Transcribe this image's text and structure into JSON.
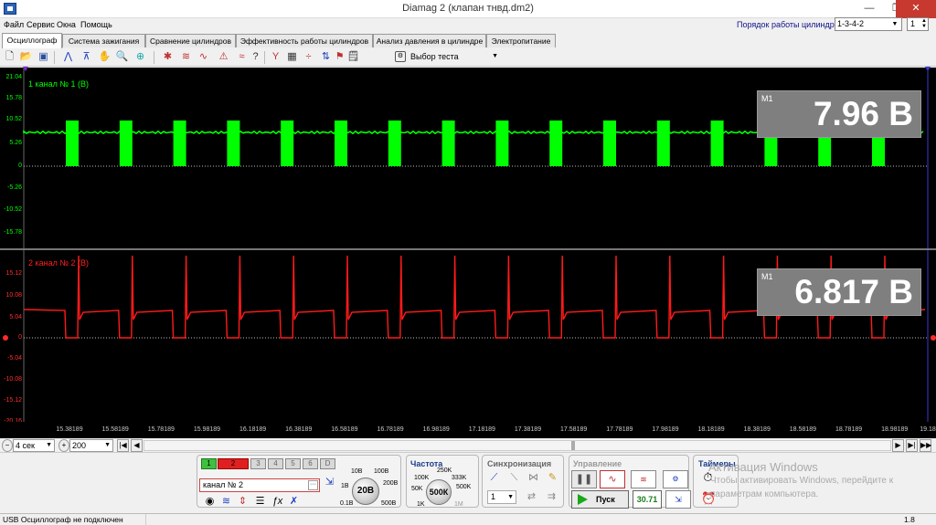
{
  "window": {
    "title": "Diamag 2 (клапан тнвд.dm2)",
    "minimize": "—",
    "maximize": "❐",
    "close": "✕"
  },
  "menu": [
    "Файл",
    "Сервис",
    "Окна",
    "Помощь"
  ],
  "cylinder_order": {
    "label": "Порядок работы цилиндров",
    "value": "1-3-4-2",
    "number": "1"
  },
  "tabs": [
    "Осциллограф",
    "Система зажигания",
    "Сравнение цилиндров",
    "Эффективность работы цилиндров",
    "Анализ давления в цилиндре",
    "Электропитание"
  ],
  "active_tab": "Осциллограф",
  "toolbar": {
    "test_select": "Выбор теста"
  },
  "channel1": {
    "label": "1  канал № 1 (В)",
    "color": "#00ff00",
    "yticks": [
      "21.04",
      "15.78",
      "10.52",
      "5.26",
      "0",
      "-5.26",
      "-10.52",
      "-15.78"
    ],
    "marker": "M1",
    "value": "7.96 В"
  },
  "channel2": {
    "label": "2  канал № 2 (В)",
    "color": "#ff1a1a",
    "yticks": [
      "15.12",
      "10.08",
      "5.04",
      "0",
      "-5.04",
      "-10.08",
      "-15.12",
      "-20.16"
    ],
    "marker": "M1",
    "value": "6.817 В"
  },
  "x_ticks": [
    "15.38189",
    "15.58189",
    "15.78189",
    "15.98189",
    "16.18189",
    "16.38189",
    "16.58189",
    "16.78189",
    "16.98189",
    "17.18189",
    "17.38189",
    "17.58189",
    "17.78189",
    "17.98189",
    "18.18189",
    "18.38189",
    "18.58189",
    "18.78189",
    "18.98189",
    "19.18189"
  ],
  "time_scale": {
    "value": "4 сек",
    "points": "200"
  },
  "controls": {
    "channel_buttons": [
      "1",
      "2",
      "3",
      "4",
      "5",
      "6",
      "D"
    ],
    "channel_name": "канал № 2",
    "range_title": "",
    "range_labels": [
      "10В",
      "100В",
      "1В",
      "200В",
      "0.1В",
      "500В"
    ],
    "range_value": "20В",
    "freq_title": "Частота",
    "freq_labels": [
      "250K",
      "100K",
      "333K",
      "50K",
      "500K",
      "1K",
      "1M"
    ],
    "freq_value": "500К",
    "sync_title": "Синхронизация",
    "sync_value": "1",
    "control_title": "Управление",
    "start_label": "Пуск",
    "frequency_readout": "30.71",
    "timers_title": "Таймеры"
  },
  "watermark": {
    "line1": "Активация Windows",
    "line2": "Чтобы активировать Windows, перейдите к",
    "line3": "параметрам компьютера."
  },
  "status": {
    "left": "USB Осциллограф не подключен",
    "right": "1.8"
  }
}
